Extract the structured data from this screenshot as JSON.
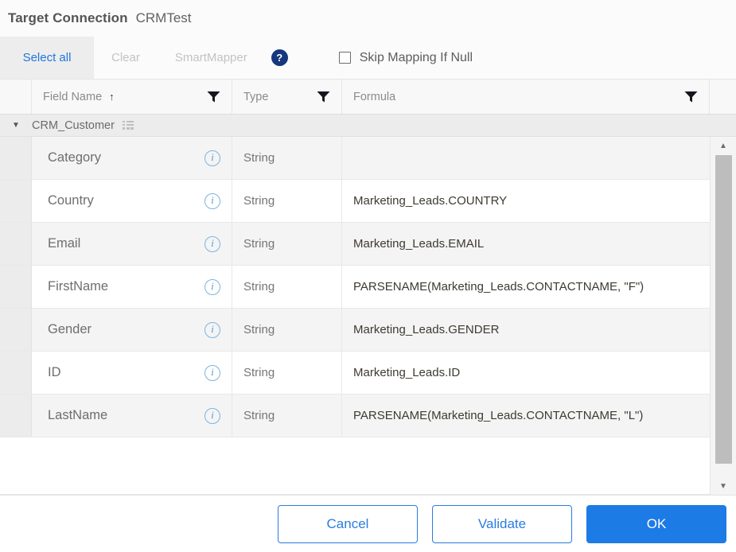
{
  "header": {
    "title": "Target Connection",
    "connection_name": "CRMTest"
  },
  "toolbar": {
    "select_all_label": "Select all",
    "clear_label": "Clear",
    "smart_mapper_label": "SmartMapper",
    "help_icon": "help-icon",
    "help_glyph": "?",
    "skip_mapping_label": "Skip Mapping If Null",
    "skip_mapping_checked": false
  },
  "grid": {
    "columns": [
      {
        "label": "Field Name",
        "sorted": "asc",
        "sort_glyph": "↑",
        "filter_icon": "filter-funnel-icon"
      },
      {
        "label": "Type",
        "filter_icon": "filter-funnel-icon"
      },
      {
        "label": "Formula",
        "filter_icon": "filter-funnel-icon"
      }
    ],
    "group": {
      "name": "CRM_Customer",
      "expanded": true,
      "caret_glyph": "▼",
      "icon": "table-grid-icon"
    },
    "rows": [
      {
        "field_name": "Category",
        "type": "String",
        "formula": ""
      },
      {
        "field_name": "Country",
        "type": "String",
        "formula": "Marketing_Leads.COUNTRY"
      },
      {
        "field_name": "Email",
        "type": "String",
        "formula": "Marketing_Leads.EMAIL"
      },
      {
        "field_name": "FirstName",
        "type": "String",
        "formula": "PARSENAME(Marketing_Leads.CONTACTNAME, \"F\")"
      },
      {
        "field_name": "Gender",
        "type": "String",
        "formula": "Marketing_Leads.GENDER"
      },
      {
        "field_name": "ID",
        "type": "String",
        "formula": "Marketing_Leads.ID"
      },
      {
        "field_name": "LastName",
        "type": "String",
        "formula": "PARSENAME(Marketing_Leads.CONTACTNAME, \"L\")"
      }
    ],
    "row_info_icon": "info-icon",
    "row_info_glyph": "i",
    "scrollbar": {
      "up_glyph": "▲",
      "down_glyph": "▼"
    }
  },
  "footer": {
    "cancel_label": "Cancel",
    "validate_label": "Validate",
    "ok_label": "OK"
  },
  "colors": {
    "accent_blue": "#1d7be5",
    "link_blue": "#2a7ce0",
    "help_navy": "#14377d",
    "info_blue": "#4a9ad4"
  }
}
